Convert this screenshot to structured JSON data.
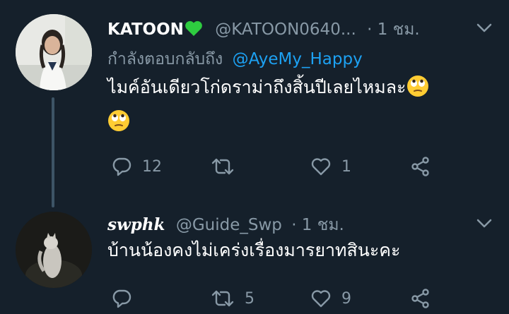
{
  "tweets": [
    {
      "display_name": "KATOON",
      "name_emoji": "💚",
      "handle": "@KATOON0640...",
      "time": "· 1 ชม.",
      "reply_prefix": "กำลังตอบกลับถึง",
      "reply_to": "@AyeMy_Happy",
      "text": "ไมค์อันเดียวโก่ดราม่าถึงสิ้นปีเลยไหมละ",
      "actions": {
        "replies": "12",
        "retweets": "",
        "likes": "1"
      }
    },
    {
      "display_name": "swphk",
      "handle": "@Guide_Swp",
      "time": "· 1 ชม.",
      "text": "บ้านน้องคงไม่เคร่งเรื่องมารยาทสินะคะ",
      "actions": {
        "replies": "",
        "retweets": "5",
        "likes": "9"
      }
    }
  ],
  "icons": [
    "chevron-down-icon",
    "reply-icon",
    "retweet-icon",
    "like-icon",
    "share-icon",
    "eye-roll-emoji"
  ],
  "colors": {
    "background": "#15202b",
    "muted": "#8899a6",
    "link": "#1da1f2",
    "text": "#ffffff",
    "heart": "#2ecc40"
  }
}
